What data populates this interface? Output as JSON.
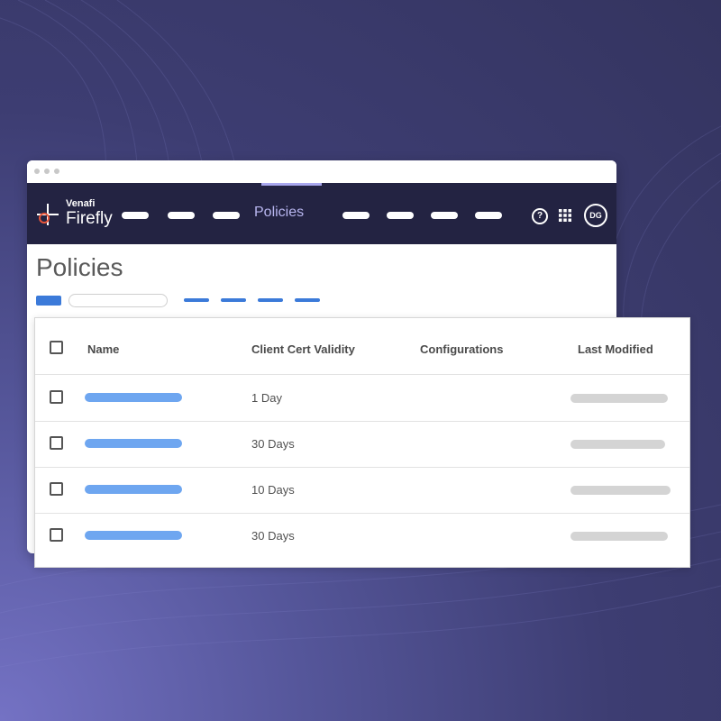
{
  "app": {
    "brand_small": "Venafi",
    "brand_name": "Firefly"
  },
  "nav": {
    "active_label": "Policies",
    "avatar_initials": "DG",
    "help_glyph": "?"
  },
  "page": {
    "title": "Policies"
  },
  "table": {
    "columns": [
      "Name",
      "Client Cert Validity",
      "Configurations",
      "Last Modified"
    ],
    "rows": [
      {
        "validity": "1 Day"
      },
      {
        "validity": "30 Days"
      },
      {
        "validity": "10 Days"
      },
      {
        "validity": "30 Days"
      }
    ]
  },
  "colors": {
    "nav_bg": "#232342",
    "accent": "#3b7ad9",
    "active_nav": "#b8b6f0",
    "name_placeholder": "#6ea6f0"
  },
  "icons": [
    "venafi-logo-icon",
    "help-icon",
    "apps-grid-icon"
  ]
}
